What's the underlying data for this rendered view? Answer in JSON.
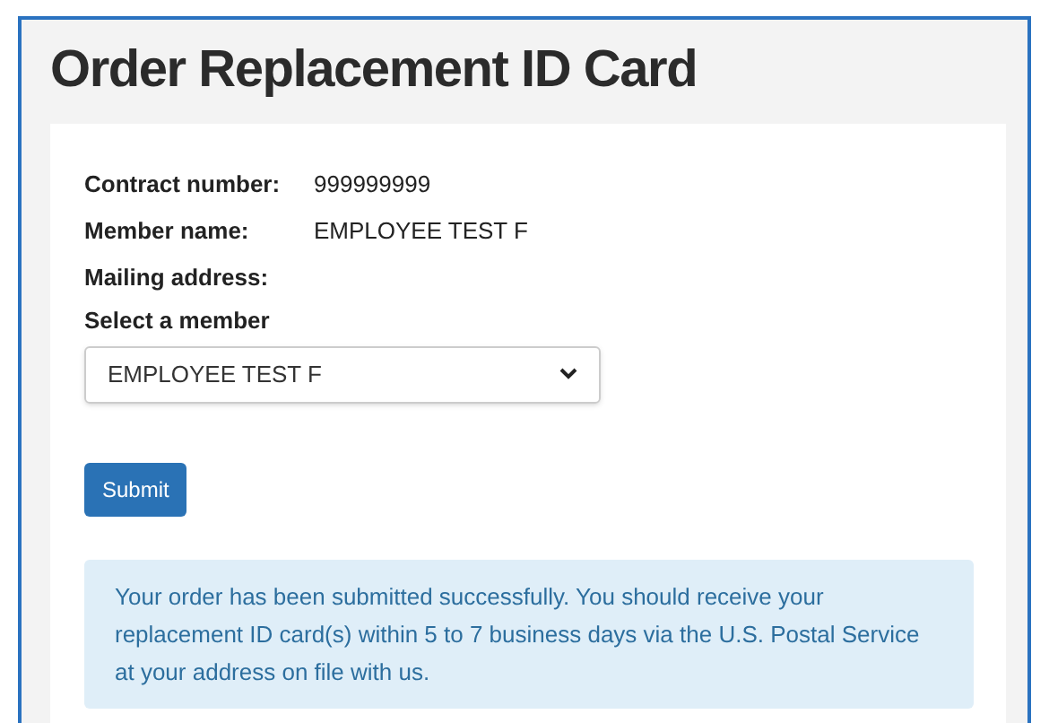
{
  "title": "Order Replacement ID Card",
  "details": [
    {
      "label": "Contract number:",
      "value": "999999999"
    },
    {
      "label": "Member name:",
      "value": "EMPLOYEE TEST F"
    },
    {
      "label": "Mailing address:"
    }
  ],
  "member_select": {
    "label": "Select a member",
    "value": "EMPLOYEE TEST F"
  },
  "submit_button": "Submit",
  "alert": "Your order has been submitted successfully. You should receive your replacement ID card(s) within 5 to 7 business days via the U.S. Postal Service at your address on file with us."
}
